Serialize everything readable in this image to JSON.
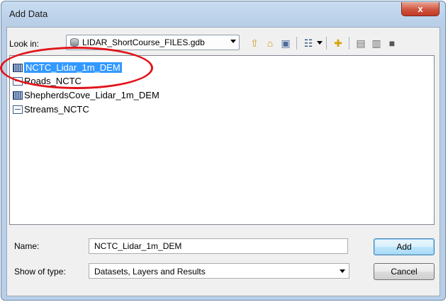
{
  "dialog": {
    "title": "Add Data",
    "close_glyph": "x"
  },
  "lookin": {
    "label": "Look in:",
    "value": "LIDAR_ShortCourse_FILES.gdb",
    "icon": "geodatabase-icon"
  },
  "toolbar": [
    {
      "name": "up-one-level-icon",
      "glyph": "⇧"
    },
    {
      "name": "home-icon",
      "glyph": "⌂"
    },
    {
      "name": "connect-folder-icon",
      "glyph": "▣"
    },
    {
      "name": "view-list-icon",
      "glyph": "☷"
    },
    {
      "name": "new-folder-icon",
      "glyph": "✚"
    },
    {
      "name": "view-details-icon",
      "glyph": "▤"
    },
    {
      "name": "catalog-icon",
      "glyph": "▥"
    },
    {
      "name": "toolbox-icon",
      "glyph": "■"
    }
  ],
  "files": [
    {
      "label": "NCTC_Lidar_1m_DEM",
      "type": "raster-dataset-icon",
      "selected": true
    },
    {
      "label": "Roads_NCTC",
      "type": "line-feature-class-icon",
      "selected": false
    },
    {
      "label": "ShepherdsCove_Lidar_1m_DEM",
      "type": "raster-dataset-icon",
      "selected": false
    },
    {
      "label": "Streams_NCTC",
      "type": "line-feature-class-icon",
      "selected": false
    }
  ],
  "name_field": {
    "label": "Name:",
    "value": "NCTC_Lidar_1m_DEM"
  },
  "type_field": {
    "label": "Show of type:",
    "value": "Datasets, Layers and Results"
  },
  "buttons": {
    "add": "Add",
    "cancel": "Cancel"
  },
  "colors": {
    "selection": "#3399ff",
    "annotation_ellipse": "#e1141b",
    "close_button": "#c23a24"
  }
}
